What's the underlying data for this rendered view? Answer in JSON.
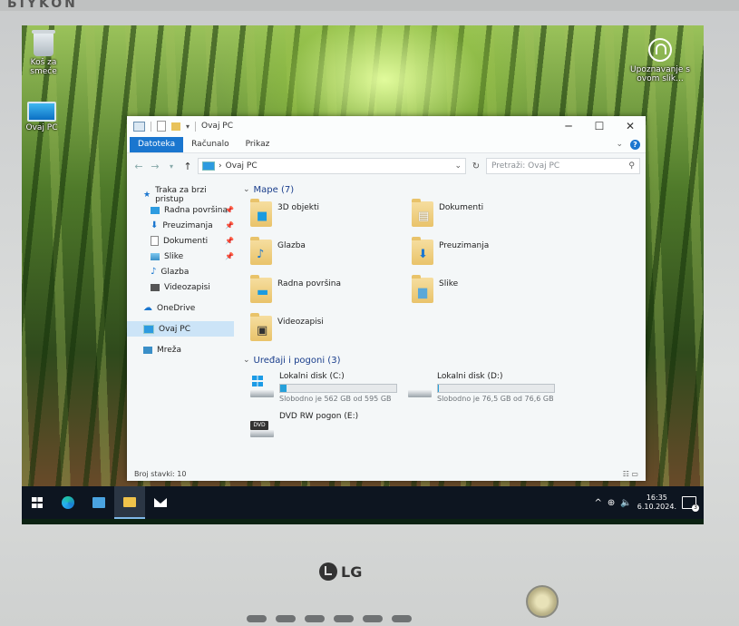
{
  "monitor": {
    "brand_top": "ЬIYKON",
    "model": "",
    "logo": "LG"
  },
  "desktop": {
    "icons": [
      {
        "label": "Koš za smeće",
        "icon": "recycle-bin-icon"
      },
      {
        "label": "Ovaj PC",
        "icon": "computer-icon"
      }
    ],
    "spotlight": {
      "label": "Upoznavanje s ovom slik..."
    }
  },
  "window": {
    "title": "Ovaj PC",
    "controls": [
      "─",
      "☐",
      "✕"
    ],
    "ribbon_tabs": [
      "Datoteka",
      "Računalo",
      "Prikaz"
    ],
    "address": {
      "path": "Ovaj PC",
      "separator": "›"
    },
    "search_placeholder": "Pretraži: Ovaj PC",
    "nav": [
      {
        "label": "Traka za brzi pristup",
        "icon": "star-icon",
        "sub": false,
        "pinned": false
      },
      {
        "label": "Radna površina",
        "icon": "desktop-icon",
        "sub": true,
        "pinned": true
      },
      {
        "label": "Preuzimanja",
        "icon": "download-icon",
        "sub": true,
        "pinned": true
      },
      {
        "label": "Dokumenti",
        "icon": "document-icon",
        "sub": true,
        "pinned": true
      },
      {
        "label": "Slike",
        "icon": "pictures-icon",
        "sub": true,
        "pinned": true
      },
      {
        "label": "Glazba",
        "icon": "music-icon",
        "sub": true,
        "pinned": false
      },
      {
        "label": "Videozapisi",
        "icon": "video-icon",
        "sub": true,
        "pinned": false
      },
      {
        "label": "OneDrive",
        "icon": "cloud-icon",
        "sub": false,
        "pinned": false
      },
      {
        "label": "Ovaj PC",
        "icon": "computer-icon",
        "sub": false,
        "pinned": false,
        "selected": true
      },
      {
        "label": "Mreža",
        "icon": "network-icon",
        "sub": false,
        "pinned": false
      }
    ],
    "folders_header": "Mape (7)",
    "folders": [
      {
        "name": "3D objekti",
        "icon": "cube-3d-icon"
      },
      {
        "name": "Dokumenti",
        "icon": "document-icon"
      },
      {
        "name": "Glazba",
        "icon": "music-icon"
      },
      {
        "name": "Preuzimanja",
        "icon": "download-icon"
      },
      {
        "name": "Radna površina",
        "icon": "desktop-icon"
      },
      {
        "name": "Slike",
        "icon": "pictures-icon"
      },
      {
        "name": "Videozapisi",
        "icon": "video-icon"
      }
    ],
    "drives_header": "Uređaji i pogoni (3)",
    "drives": [
      {
        "name": "Lokalni disk (C:)",
        "free": "Slobodno je 562 GB od 595 GB",
        "used_fraction": 0.055,
        "icon": "windows-drive-icon",
        "bar": true
      },
      {
        "name": "Lokalni disk (D:)",
        "free": "Slobodno je 76,5 GB od 76,6 GB",
        "used_fraction": 0.001,
        "icon": "drive-icon",
        "bar": true
      },
      {
        "name": "DVD RW pogon (E:)",
        "free": "",
        "used_fraction": 0,
        "icon": "dvd-drive-icon",
        "bar": false
      }
    ],
    "status": "Broj stavki: 10"
  },
  "taskbar": {
    "apps": [
      "start-icon",
      "edge-icon",
      "store-icon",
      "file-explorer-icon",
      "mail-icon"
    ],
    "time": "16:35",
    "date": "6.10.2024.",
    "notifications": "3"
  },
  "colors": {
    "accent": "#1a76cf",
    "selection": "#cce4f7",
    "bar_fill": "#26a0da"
  }
}
